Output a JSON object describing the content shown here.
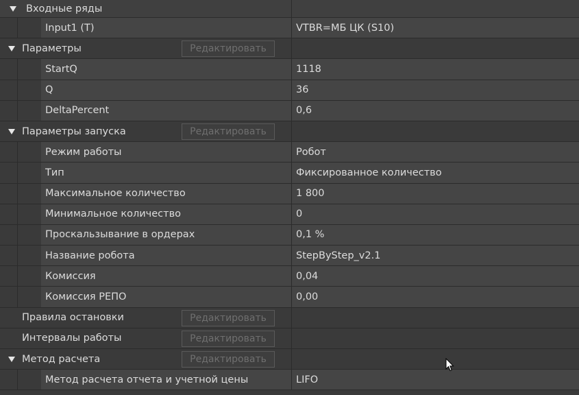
{
  "groups": {
    "inputs": {
      "title": "Входные ряды",
      "items": [
        {
          "name": "Input1 (T)",
          "value": "VTBR=МБ ЦК (S10)"
        }
      ]
    },
    "params": {
      "title": "Параметры",
      "edit_label": "Редактировать",
      "items": [
        {
          "name": "StartQ",
          "value": "1118"
        },
        {
          "name": "Q",
          "value": "36"
        },
        {
          "name": "DeltaPercent",
          "value": "0,6"
        }
      ]
    },
    "launch": {
      "title": "Параметры запуска",
      "edit_label": "Редактировать",
      "items": [
        {
          "name": "Режим работы",
          "value": "Робот"
        },
        {
          "name": "Тип",
          "value": "Фиксированное количество"
        },
        {
          "name": "Максимальное количество",
          "value": "1 800"
        },
        {
          "name": "Минимальное количество",
          "value": "0"
        },
        {
          "name": "Проскальзывание в ордерах",
          "value": "0,1 %"
        },
        {
          "name": "Название робота",
          "value": "StepByStep_v2.1"
        },
        {
          "name": "Комиссия",
          "value": "0,04"
        },
        {
          "name": "Комиссия РЕПО",
          "value": "0,00"
        }
      ]
    },
    "stop_rules": {
      "title": "Правила остановки",
      "edit_label": "Редактировать"
    },
    "intervals": {
      "title": "Интервалы работы",
      "edit_label": "Редактировать"
    },
    "calc": {
      "title": "Метод расчета",
      "edit_label": "Редактировать",
      "items": [
        {
          "name": "Метод расчета отчета и учетной цены",
          "value": "LIFO"
        }
      ]
    }
  }
}
